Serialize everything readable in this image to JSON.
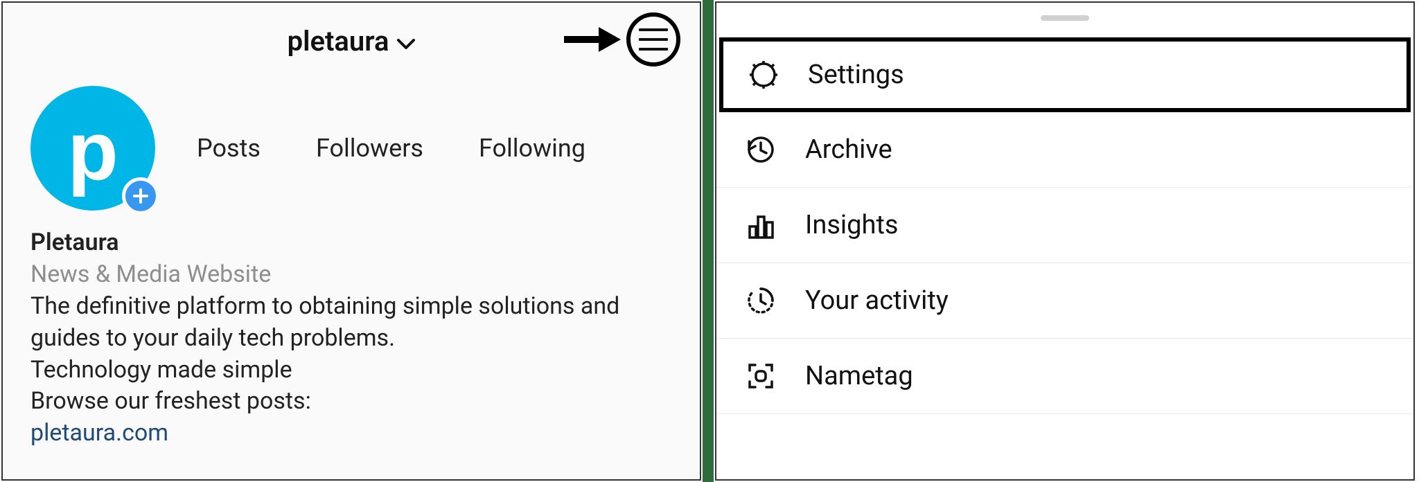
{
  "profile": {
    "username": "pletaura",
    "avatar_letter": "p",
    "stats": {
      "posts_label": "Posts",
      "followers_label": "Followers",
      "following_label": "Following"
    },
    "display_name": "Pletaura",
    "category": "News & Media Website",
    "bio_line1": "The definitive platform to obtaining simple solutions and",
    "bio_line2": "guides to your daily tech problems.",
    "bio_line3": "Technology made simple",
    "bio_line4": "Browse our freshest posts:",
    "link": "pletaura.com"
  },
  "menu": {
    "items": [
      {
        "label": "Settings",
        "icon": "gear-icon",
        "highlight": true
      },
      {
        "label": "Archive",
        "icon": "archive-icon",
        "highlight": false
      },
      {
        "label": "Insights",
        "icon": "insights-icon",
        "highlight": false
      },
      {
        "label": "Your activity",
        "icon": "activity-icon",
        "highlight": false
      },
      {
        "label": "Nametag",
        "icon": "nametag-icon",
        "highlight": false
      }
    ]
  }
}
